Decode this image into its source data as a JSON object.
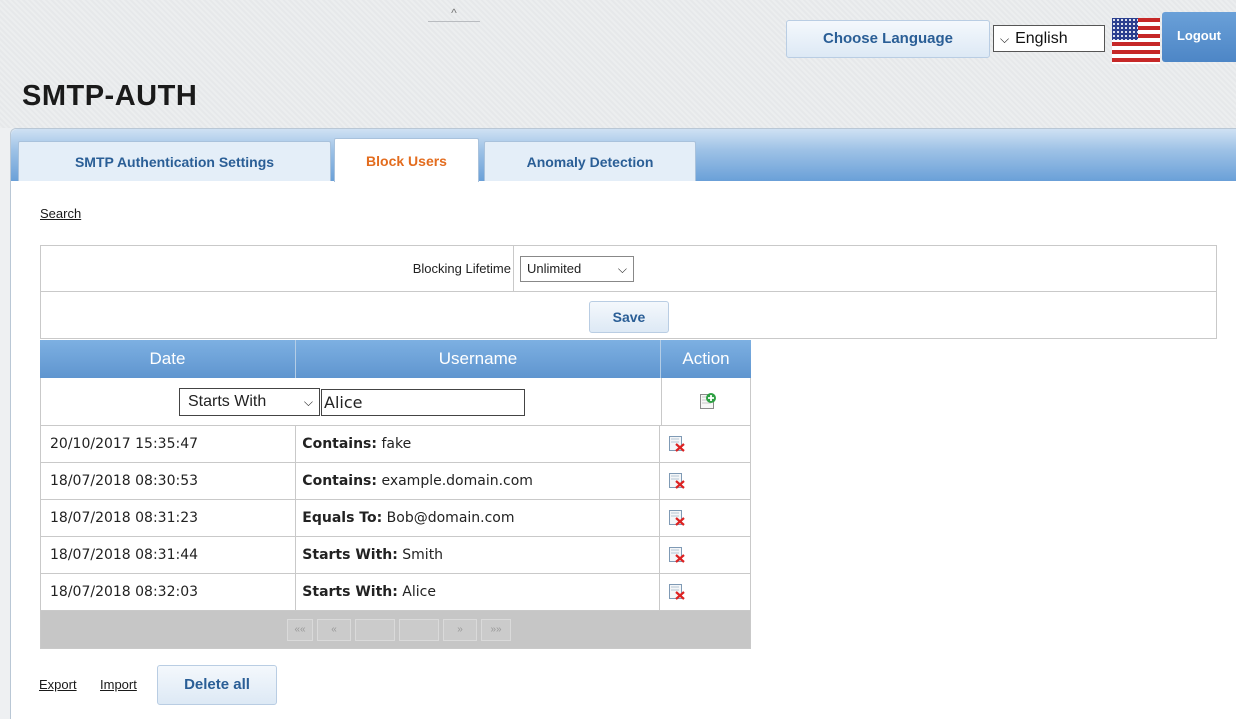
{
  "header": {
    "collapse_glyph": "^",
    "choose_language_label": "Choose Language",
    "language_value": "English",
    "language_chevron": "⌵",
    "logout_label": "Logout",
    "page_title": "SMTP-AUTH"
  },
  "tabs": [
    {
      "label": "SMTP Authentication Settings",
      "active": false
    },
    {
      "label": "Block Users",
      "active": true
    },
    {
      "label": "Anomaly Detection",
      "active": false
    }
  ],
  "search_link": "Search",
  "settings": {
    "blocking_lifetime_label": "Blocking Lifetime",
    "blocking_lifetime_value": "Unlimited",
    "save_label": "Save"
  },
  "table": {
    "headers": [
      "Date",
      "Username",
      "Action"
    ],
    "filter": {
      "match_type": "Starts With",
      "value": "Alice"
    },
    "rows": [
      {
        "date": "20/10/2017 15:35:47",
        "match": "Contains:",
        "value": "fake"
      },
      {
        "date": "18/07/2018 08:30:53",
        "match": "Contains:",
        "value": "example.domain.com"
      },
      {
        "date": "18/07/2018 08:31:23",
        "match": "Equals To:",
        "value": "Bob@domain.com"
      },
      {
        "date": "18/07/2018 08:31:44",
        "match": "Starts With:",
        "value": "Smith"
      },
      {
        "date": "18/07/2018 08:32:03",
        "match": "Starts With:",
        "value": "Alice"
      }
    ],
    "pager": {
      "first": "««",
      "prev": "«",
      "next": "»",
      "last": "»»"
    }
  },
  "footer": {
    "export_label": "Export",
    "import_label": "Import",
    "delete_all_label": "Delete all"
  },
  "colors": {
    "accent": "#2a5e96",
    "active_tab": "#e36c1e",
    "header_blue": "#6aa0d8"
  }
}
